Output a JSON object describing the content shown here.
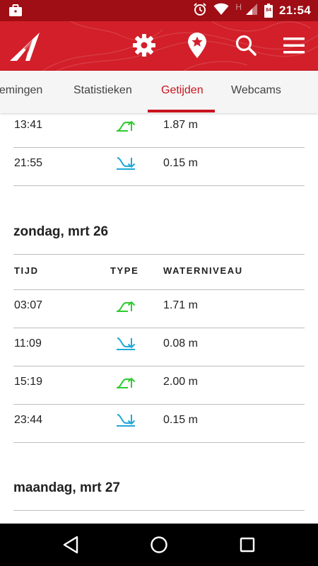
{
  "status_bar": {
    "time": "21:54",
    "network_hint": "H",
    "battery_level": "84",
    "icons": [
      "briefcase-icon",
      "alarm-icon",
      "wifi-icon",
      "signal-icon",
      "battery-icon"
    ]
  },
  "app_bar": {
    "background_color": "#d21f2a",
    "icons": [
      "logo-icon",
      "gear-icon",
      "favorite-location-icon",
      "search-icon",
      "menu-icon"
    ]
  },
  "tabs": {
    "items": [
      {
        "label": "metingen",
        "display_text": "nemingen"
      },
      {
        "label": "Statistieken"
      },
      {
        "label": "Getijden"
      },
      {
        "label": "Webcams"
      }
    ],
    "active_index": 2,
    "active_color": "#c9141f"
  },
  "colors": {
    "rising": "#2ecc2e",
    "falling": "#1fa8d8"
  },
  "partial_day": {
    "rows": [
      {
        "time": "13:41",
        "type": "rising",
        "level": "1.87 m"
      },
      {
        "time": "21:55",
        "type": "falling",
        "level": "0.15 m"
      }
    ]
  },
  "day_1": {
    "title": "zondag, mrt 26",
    "headers": {
      "time": "TIJD",
      "type": "TYPE",
      "level": "WATERNIVEAU"
    },
    "rows": [
      {
        "time": "03:07",
        "type": "rising",
        "level": "1.71 m"
      },
      {
        "time": "11:09",
        "type": "falling",
        "level": "0.08 m"
      },
      {
        "time": "15:19",
        "type": "rising",
        "level": "2.00 m"
      },
      {
        "time": "23:44",
        "type": "falling",
        "level": "0.15 m"
      }
    ]
  },
  "day_2": {
    "title": "maandag, mrt 27"
  },
  "nav_bar": {
    "icons": [
      "back-icon",
      "home-icon",
      "recents-icon"
    ]
  }
}
